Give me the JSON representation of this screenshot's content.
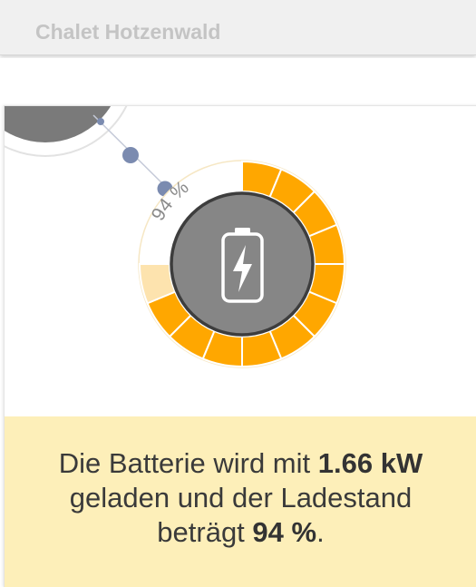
{
  "header": {
    "title": "Chalet Hotzenwald"
  },
  "battery": {
    "state_of_charge_percent": 94,
    "soc_label": "94 %",
    "charging": true,
    "colors": {
      "filled": "#ffa700",
      "unfilled": "#fde3ae",
      "center": "#868686",
      "center_border": "#3d3d3d",
      "flow_line": "#7b8bb0"
    }
  },
  "message": {
    "part1": "Die Batterie wird mit",
    "power": "1.66 kW",
    "part2": "geladen und der Ladestand",
    "part3": "beträgt",
    "soc": "94 %",
    "end": "."
  }
}
